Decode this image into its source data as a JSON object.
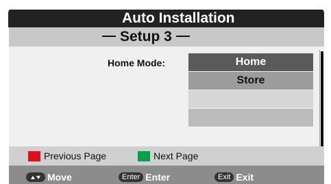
{
  "window": {
    "title": "Auto Installation"
  },
  "setup": {
    "step_title": "Setup 3"
  },
  "home_mode": {
    "label": "Home Mode:",
    "options": [
      "Home",
      "Store",
      "",
      ""
    ],
    "selected": "Home"
  },
  "hints": {
    "previous": {
      "label": "Previous Page",
      "color": "#e0101a"
    },
    "next": {
      "label": "Next Page",
      "color": "#00a14b"
    }
  },
  "nav": {
    "move": {
      "key_icon": "up-down-arrows-icon",
      "label": "Move"
    },
    "enter": {
      "key": "Enter",
      "label": "Enter"
    },
    "exit": {
      "key": "Exit",
      "label": "Exit"
    }
  }
}
